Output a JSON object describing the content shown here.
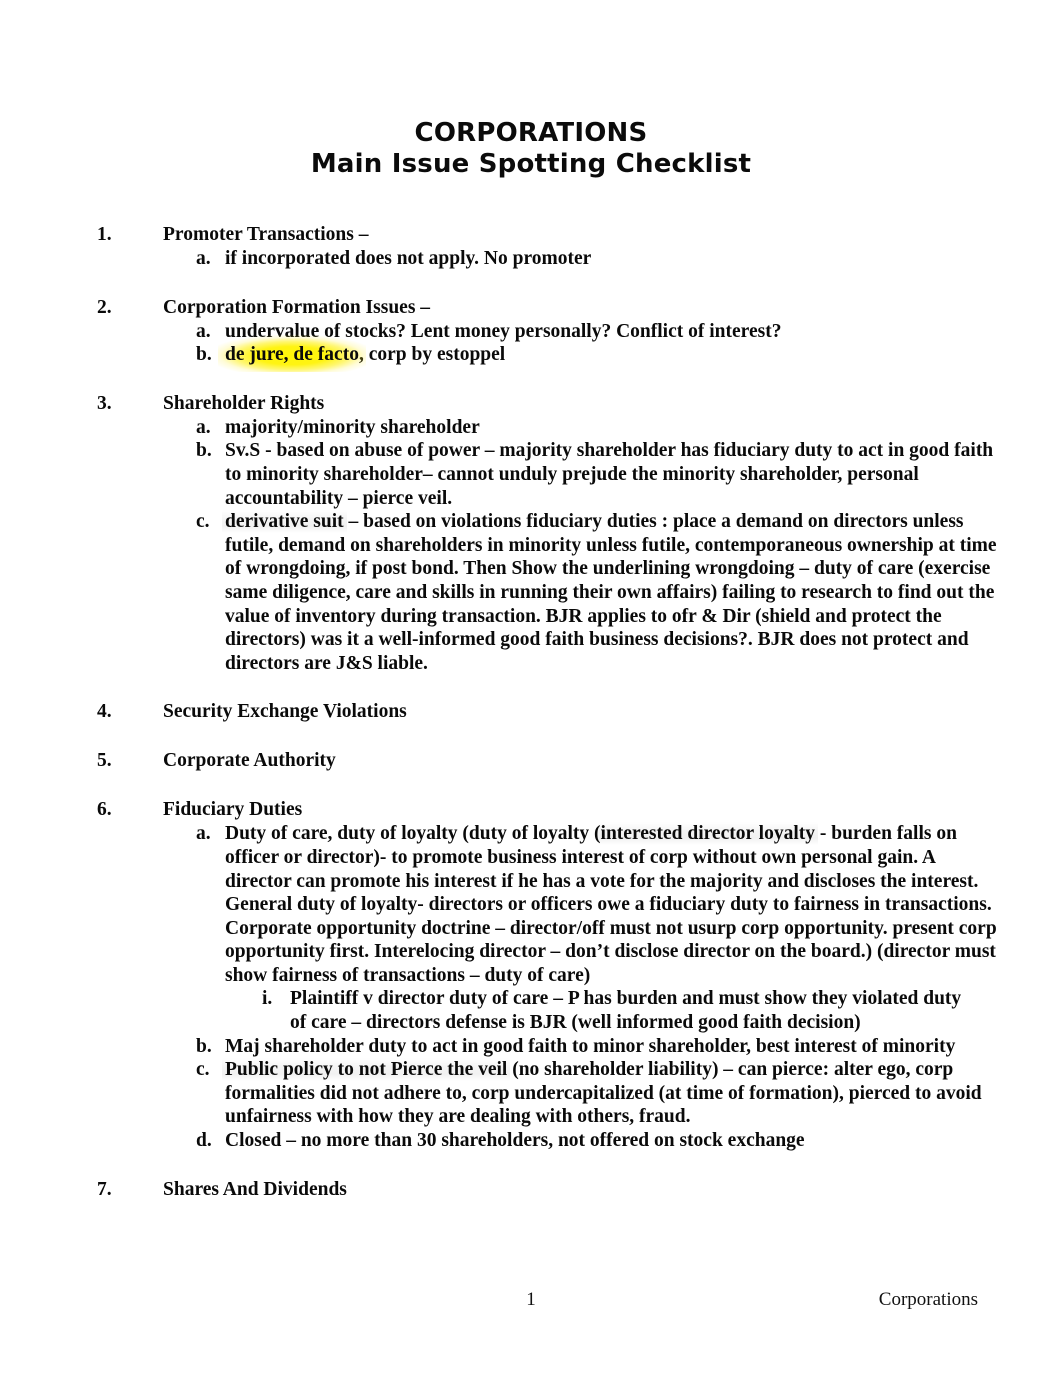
{
  "document": {
    "title": "CORPORATIONS",
    "subtitle": "Main Issue Spotting Checklist"
  },
  "outline": [
    {
      "marker": "1.",
      "heading": "Promoter Transactions –",
      "children": [
        {
          "marker": "a.",
          "text": "if incorporated does not apply. No promoter"
        }
      ]
    },
    {
      "marker": "2.",
      "heading": "Corporation Formation Issues –",
      "children": [
        {
          "marker": "a.",
          "text": " undervalue of stocks? Lent money personally? Conflict of interest?"
        },
        {
          "marker": "b.",
          "highlight_yellow": "de jure, de facto",
          "text": ", corp by estoppel"
        }
      ]
    },
    {
      "marker": "3.",
      "heading": "Shareholder Rights",
      "children": [
        {
          "marker": "a.",
          "text": "majority/minority shareholder"
        },
        {
          "marker": "b.",
          "text": "Sv.S - based on abuse of power – majority shareholder has fiduciary duty to act in good faith to minority shareholder– cannot unduly prejude the minority shareholder, personal accountability – pierce veil."
        },
        {
          "marker": "c.",
          "highlight_gray": "derivative suit",
          "text": " – based on violations fiduciary duties : place a demand on directors unless futile, demand on shareholders in minority unless futile, contemporaneous ownership at time of wrongdoing, if post bond. Then Show the underlining wrongdoing – duty of care (exercise same diligence, care and skills in running their own affairs) failing to research to find out the value of inventory during transaction. BJR applies to ofr & Dir (shield and protect the directors) was it a well-informed good faith business decisions?. BJR does not protect and directors are J&S liable."
        }
      ]
    },
    {
      "marker": "4.",
      "heading": "Security Exchange Violations",
      "children": []
    },
    {
      "marker": "5.",
      "heading": "Corporate Authority",
      "children": []
    },
    {
      "marker": "6.",
      "heading": "Fiduciary Duties",
      "children": [
        {
          "marker": "a.",
          "text_pre": "Duty of care, duty of loyalty (duty of loyalty (",
          "highlight_gray": "interested director loyalty",
          "text": " - burden falls on officer or director)- to promote business interest of corp without own personal gain. A director can promote his interest if he has a vote for the majority and discloses the interest. General duty of loyalty- directors or officers owe a fiduciary duty to fairness in transactions. Corporate opportunity doctrine – director/off must not usurp corp opportunity. present corp opportunity first. Interelocing director – don’t disclose director on the board.) (director must show fairness of transactions – duty of care)",
          "subchildren": [
            {
              "marker": "i.",
              "text": "Plaintiff v director duty of care – P has burden and must show they violated duty of care – directors defense is BJR (well informed good faith decision)"
            }
          ]
        },
        {
          "marker": "b.",
          "text": "Maj shareholder duty to act in good faith to minor shareholder, best interest of minority"
        },
        {
          "marker": "c.",
          "highlight_gray": "Public policy to not Pierce the veil",
          "text": " (no shareholder liability) – can pierce: alter ego, corp formalities did not adhere to, corp undercapitalized (at time of formation), pierced to avoid unfairness with how they are dealing with others, fraud."
        },
        {
          "marker": "d.",
          "text": "Closed – no more than 30 shareholders, not offered on stock exchange"
        }
      ]
    },
    {
      "marker": "7.",
      "heading": "Shares And Dividends",
      "children": []
    }
  ],
  "footer": {
    "page_number": "1",
    "right_label": "Corporations"
  },
  "colors": {
    "highlight_yellow": "#fff600",
    "highlight_gray": "#ebebeb",
    "text": "#000000",
    "page_background": "#ffffff"
  }
}
